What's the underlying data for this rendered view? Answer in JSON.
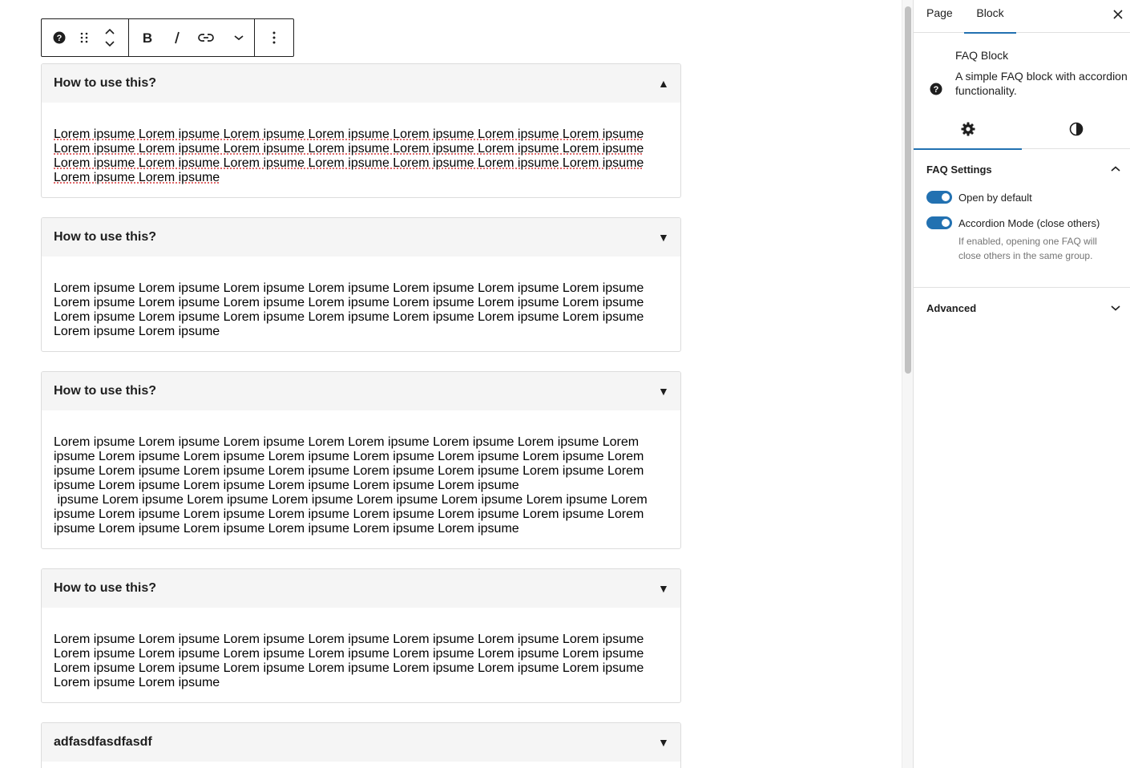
{
  "toolbar": {
    "buttons": [
      {
        "name": "block-type-icon",
        "label": "FAQ Block"
      },
      {
        "name": "drag-handle-icon",
        "label": "Drag"
      },
      {
        "name": "move-up-icon",
        "label": "Move up"
      },
      {
        "name": "move-down-icon",
        "label": "Move down"
      },
      {
        "name": "bold-icon",
        "label": "Bold"
      },
      {
        "name": "italic-icon",
        "label": "Italic"
      },
      {
        "name": "link-icon",
        "label": "Link"
      },
      {
        "name": "more-rich-text-icon",
        "label": "More"
      },
      {
        "name": "options-icon",
        "label": "Options"
      }
    ]
  },
  "faqs": [
    {
      "question": "How to use this?",
      "toggle": "▲",
      "state": "open",
      "spellcheck": true,
      "lines": [
        "Lorem ipsume Lorem ipsume Lorem ipsume Lorem ipsume Lorem ipsume Lorem ipsume Lorem ipsume",
        "Lorem ipsume Lorem ipsume Lorem ipsume Lorem ipsume Lorem ipsume Lorem ipsume Lorem ipsume",
        "Lorem ipsume Lorem ipsume Lorem ipsume Lorem ipsume Lorem ipsume Lorem ipsume Lorem ipsume",
        "Lorem ipsume Lorem ipsume"
      ]
    },
    {
      "question": "How to use this?",
      "toggle": "▼",
      "state": "closed",
      "spellcheck": false,
      "lines": [
        "Lorem ipsume Lorem ipsume Lorem ipsume Lorem ipsume Lorem ipsume Lorem ipsume Lorem ipsume",
        "Lorem ipsume Lorem ipsume Lorem ipsume Lorem ipsume Lorem ipsume Lorem ipsume Lorem ipsume",
        "Lorem ipsume Lorem ipsume Lorem ipsume Lorem ipsume Lorem ipsume Lorem ipsume Lorem ipsume",
        "Lorem ipsume Lorem ipsume"
      ]
    },
    {
      "question": "How to use this?",
      "toggle": "▼",
      "state": "closed",
      "spellcheck": false,
      "lines": [
        "Lorem ipsume Lorem ipsume Lorem ipsume Lorem Lorem ipsume Lorem ipsume Lorem ipsume Lorem",
        "ipsume Lorem ipsume Lorem ipsume Lorem ipsume Lorem ipsume Lorem ipsume Lorem ipsume Lorem",
        "ipsume Lorem ipsume Lorem ipsume Lorem ipsume Lorem ipsume Lorem ipsume Lorem ipsume Lorem",
        "ipsume Lorem ipsume Lorem ipsume Lorem ipsume Lorem ipsume Lorem ipsume",
        " ipsume Lorem ipsume Lorem ipsume Lorem ipsume Lorem ipsume Lorem ipsume Lorem ipsume Lorem",
        "ipsume Lorem ipsume Lorem ipsume Lorem ipsume Lorem ipsume Lorem ipsume Lorem ipsume Lorem",
        "ipsume Lorem ipsume Lorem ipsume Lorem ipsume Lorem ipsume Lorem ipsume"
      ]
    },
    {
      "question": "How to use this?",
      "toggle": "▼",
      "state": "closed",
      "spellcheck": false,
      "lines": [
        "Lorem ipsume Lorem ipsume Lorem ipsume Lorem ipsume Lorem ipsume Lorem ipsume Lorem ipsume",
        "Lorem ipsume Lorem ipsume Lorem ipsume Lorem ipsume Lorem ipsume Lorem ipsume Lorem ipsume",
        "Lorem ipsume Lorem ipsume Lorem ipsume Lorem ipsume Lorem ipsume Lorem ipsume Lorem ipsume",
        "Lorem ipsume Lorem ipsume"
      ]
    },
    {
      "question": "adfasdfasdfasdf",
      "toggle": "▼",
      "state": "closed",
      "spellcheck": false,
      "lines": []
    }
  ],
  "sidebar": {
    "tabs": [
      {
        "label": "Page",
        "active": false
      },
      {
        "label": "Block",
        "active": true
      }
    ],
    "close_icon": "close-icon",
    "block": {
      "icon": "help-icon",
      "title": "FAQ Block",
      "description": "A simple FAQ block with accordion functionality."
    },
    "subtabs": [
      {
        "icon": "settings-icon",
        "active": true
      },
      {
        "icon": "styles-icon",
        "active": false
      }
    ],
    "faq_settings": {
      "title": "FAQ Settings",
      "expanded": true,
      "open_by_default": {
        "label": "Open by default",
        "checked": true
      },
      "accordion_mode": {
        "label": "Accordion Mode (close others)",
        "checked": true
      },
      "help": "If enabled, opening one FAQ will close others in the same group."
    },
    "advanced": {
      "title": "Advanced",
      "expanded": false
    }
  },
  "colors": {
    "accent": "#2271b1",
    "text": "#1e1e1e",
    "muted": "#757575",
    "header_bg": "#f5f5f5",
    "border": "#dcdcdc",
    "spellcheck": "#d63638"
  }
}
